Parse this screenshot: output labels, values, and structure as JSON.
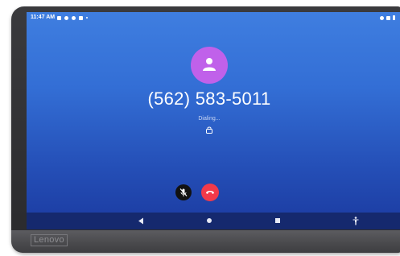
{
  "device": {
    "brand": "Lenovo"
  },
  "status_bar": {
    "time": "11:47 AM",
    "left_icons": [
      "message-icon",
      "phone-icon",
      "settings-icon",
      "media-icon",
      "dot-icon"
    ],
    "right_icons": [
      "vpn-key-icon",
      "wifi-icon",
      "battery-icon"
    ]
  },
  "call": {
    "number": "(562) 583-5011",
    "status": "Dialing...",
    "avatar_color": "#c061ea",
    "end_call_color": "#f23a4a"
  },
  "controls": {
    "mute": "mute-icon",
    "end_call": "end-call-icon"
  },
  "navigation": {
    "back": "back-icon",
    "home": "home-icon",
    "recents": "recents-icon",
    "accessibility": "accessibility-icon"
  },
  "colors": {
    "screen_top": "#3f7ee0",
    "screen_bottom": "#1b3aa0",
    "nav_bar": "#15296e"
  }
}
